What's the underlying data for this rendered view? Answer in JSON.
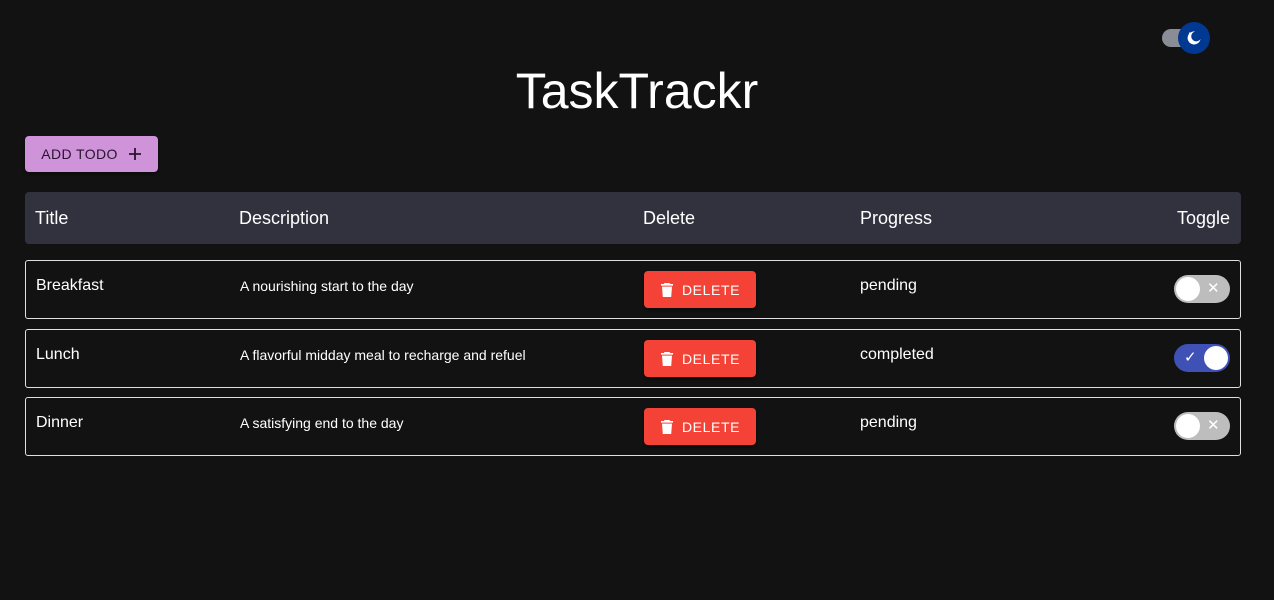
{
  "app": {
    "title": "TaskTrackr"
  },
  "theme_toggle": {
    "icon": "moon-icon",
    "thumb_color": "#003892",
    "track_color": "#8a8d96"
  },
  "toolbar": {
    "add_label": "ADD TODO",
    "add_icon": "plus-icon",
    "add_color": "#ce93d8"
  },
  "table": {
    "headers": {
      "title": "Title",
      "description": "Description",
      "delete": "Delete",
      "progress": "Progress",
      "toggle": "Toggle"
    },
    "rows": [
      {
        "title": "Breakfast",
        "description": "A nourishing start to the day",
        "delete_label": "DELETE",
        "progress": "pending",
        "toggle": false
      },
      {
        "title": "Lunch",
        "description": "A flavorful midday meal to recharge and refuel",
        "delete_label": "DELETE",
        "progress": "completed",
        "toggle": true
      },
      {
        "title": "Dinner",
        "description": "A satisfying end to the day",
        "delete_label": "DELETE",
        "progress": "pending",
        "toggle": false
      }
    ]
  },
  "colors": {
    "background": "#121212",
    "header_background": "#32323f",
    "delete": "#f44336",
    "toggle_on": "#3f51b5",
    "toggle_off": "#bdbdbd"
  }
}
